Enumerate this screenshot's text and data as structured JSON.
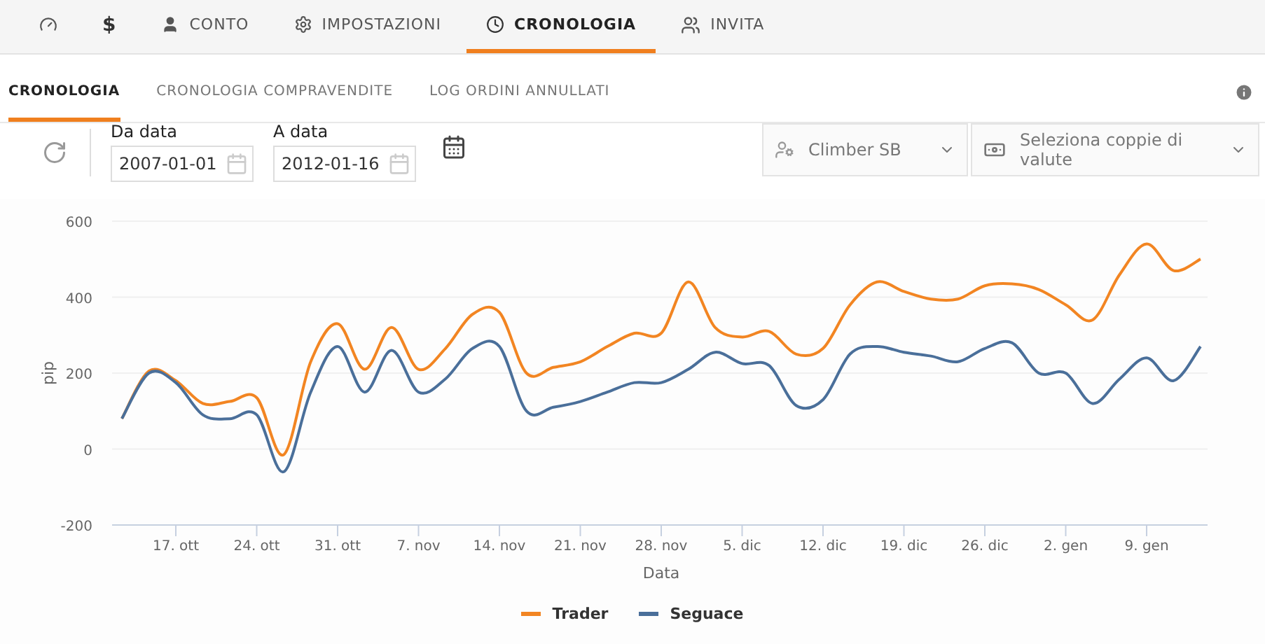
{
  "top_nav": [
    {
      "selected": false
    },
    {
      "label": "$",
      "selected": false
    },
    {
      "label": "CONTO",
      "selected": false
    },
    {
      "label": "IMPOSTAZIONI",
      "selected": false
    },
    {
      "label": "CRONOLOGIA",
      "selected": true
    },
    {
      "label": "INVITA",
      "selected": false
    }
  ],
  "sub_tabs": [
    {
      "label": "CRONOLOGIA",
      "selected": true
    },
    {
      "label": "CRONOLOGIA COMPRAVENDITE",
      "selected": false
    },
    {
      "label": "LOG ORDINI ANNULLATI",
      "selected": false
    }
  ],
  "filters": {
    "from": {
      "label": "Da data",
      "value": "2007-01-01"
    },
    "to": {
      "label": "A data",
      "value": "2012-01-16"
    },
    "trader_select": {
      "value": "Climber SB"
    },
    "pairs_select": {
      "placeholder": "Seleziona coppie di valute"
    }
  },
  "chart_data": {
    "type": "line",
    "grid": true,
    "xlabel": "Data",
    "ylabel": "pip",
    "ylim": [
      -200,
      600
    ],
    "yticks": [
      -200,
      0,
      200,
      400,
      600
    ],
    "categories": [
      null,
      null,
      "17. ott",
      null,
      null,
      "24. ott",
      null,
      null,
      "31. ott",
      null,
      null,
      "7. nov",
      null,
      null,
      "14. nov",
      null,
      null,
      "21. nov",
      null,
      null,
      "28. nov",
      null,
      null,
      "5. dic",
      null,
      null,
      "12. dic",
      null,
      null,
      "19. dic",
      null,
      null,
      "26. dic",
      null,
      null,
      "2. gen",
      null,
      null,
      "9. gen",
      null,
      null
    ],
    "series": [
      {
        "name": "Trader",
        "color": "#f28522",
        "values": [
          80,
          205,
          180,
          120,
          125,
          135,
          -15,
          230,
          330,
          210,
          320,
          210,
          265,
          355,
          360,
          200,
          215,
          230,
          270,
          305,
          305,
          440,
          320,
          295,
          310,
          250,
          265,
          380,
          440,
          415,
          395,
          395,
          430,
          435,
          420,
          380,
          340,
          460,
          540,
          470,
          500
        ]
      },
      {
        "name": "Seguace",
        "color": "#4a6f9a",
        "values": [
          80,
          200,
          175,
          90,
          80,
          90,
          -60,
          150,
          270,
          150,
          260,
          150,
          185,
          265,
          270,
          100,
          110,
          125,
          150,
          175,
          175,
          210,
          255,
          225,
          220,
          115,
          130,
          250,
          270,
          255,
          245,
          230,
          265,
          280,
          200,
          200,
          120,
          185,
          240,
          180,
          270
        ]
      }
    ]
  }
}
